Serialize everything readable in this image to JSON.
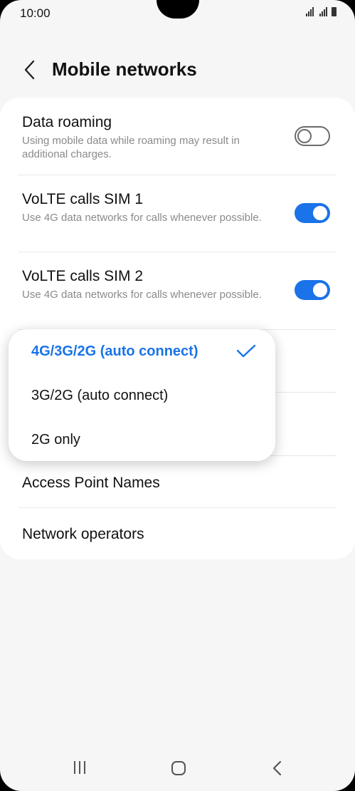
{
  "status_bar": {
    "time": "10:00"
  },
  "header": {
    "title": "Mobile networks"
  },
  "settings": {
    "data_roaming": {
      "title": "Data roaming",
      "subtitle": "Using mobile data while roaming may result in additional charges.",
      "enabled": false
    },
    "volte_sim1": {
      "title": "VoLTE calls SIM 1",
      "subtitle": "Use 4G data networks for calls whenever possible.",
      "enabled": true
    },
    "volte_sim2": {
      "title": "VoLTE calls SIM 2",
      "subtitle": "Use 4G data networks for calls whenever possible.",
      "enabled": true
    },
    "access_point_names": {
      "title": "Access Point Names"
    },
    "network_operators": {
      "title": "Network operators"
    }
  },
  "network_mode_menu": {
    "options": [
      {
        "label": "4G/3G/2G (auto connect)",
        "selected": true
      },
      {
        "label": "3G/2G (auto connect)",
        "selected": false
      },
      {
        "label": "2G only",
        "selected": false
      }
    ]
  },
  "colors": {
    "accent": "#1a73e8",
    "background": "#f6f6f6",
    "card": "#ffffff"
  },
  "icons": {
    "back": "chevron-left-icon",
    "check": "check-icon",
    "nav_recents": "recents-icon",
    "nav_home": "home-icon",
    "nav_back": "nav-back-icon"
  }
}
